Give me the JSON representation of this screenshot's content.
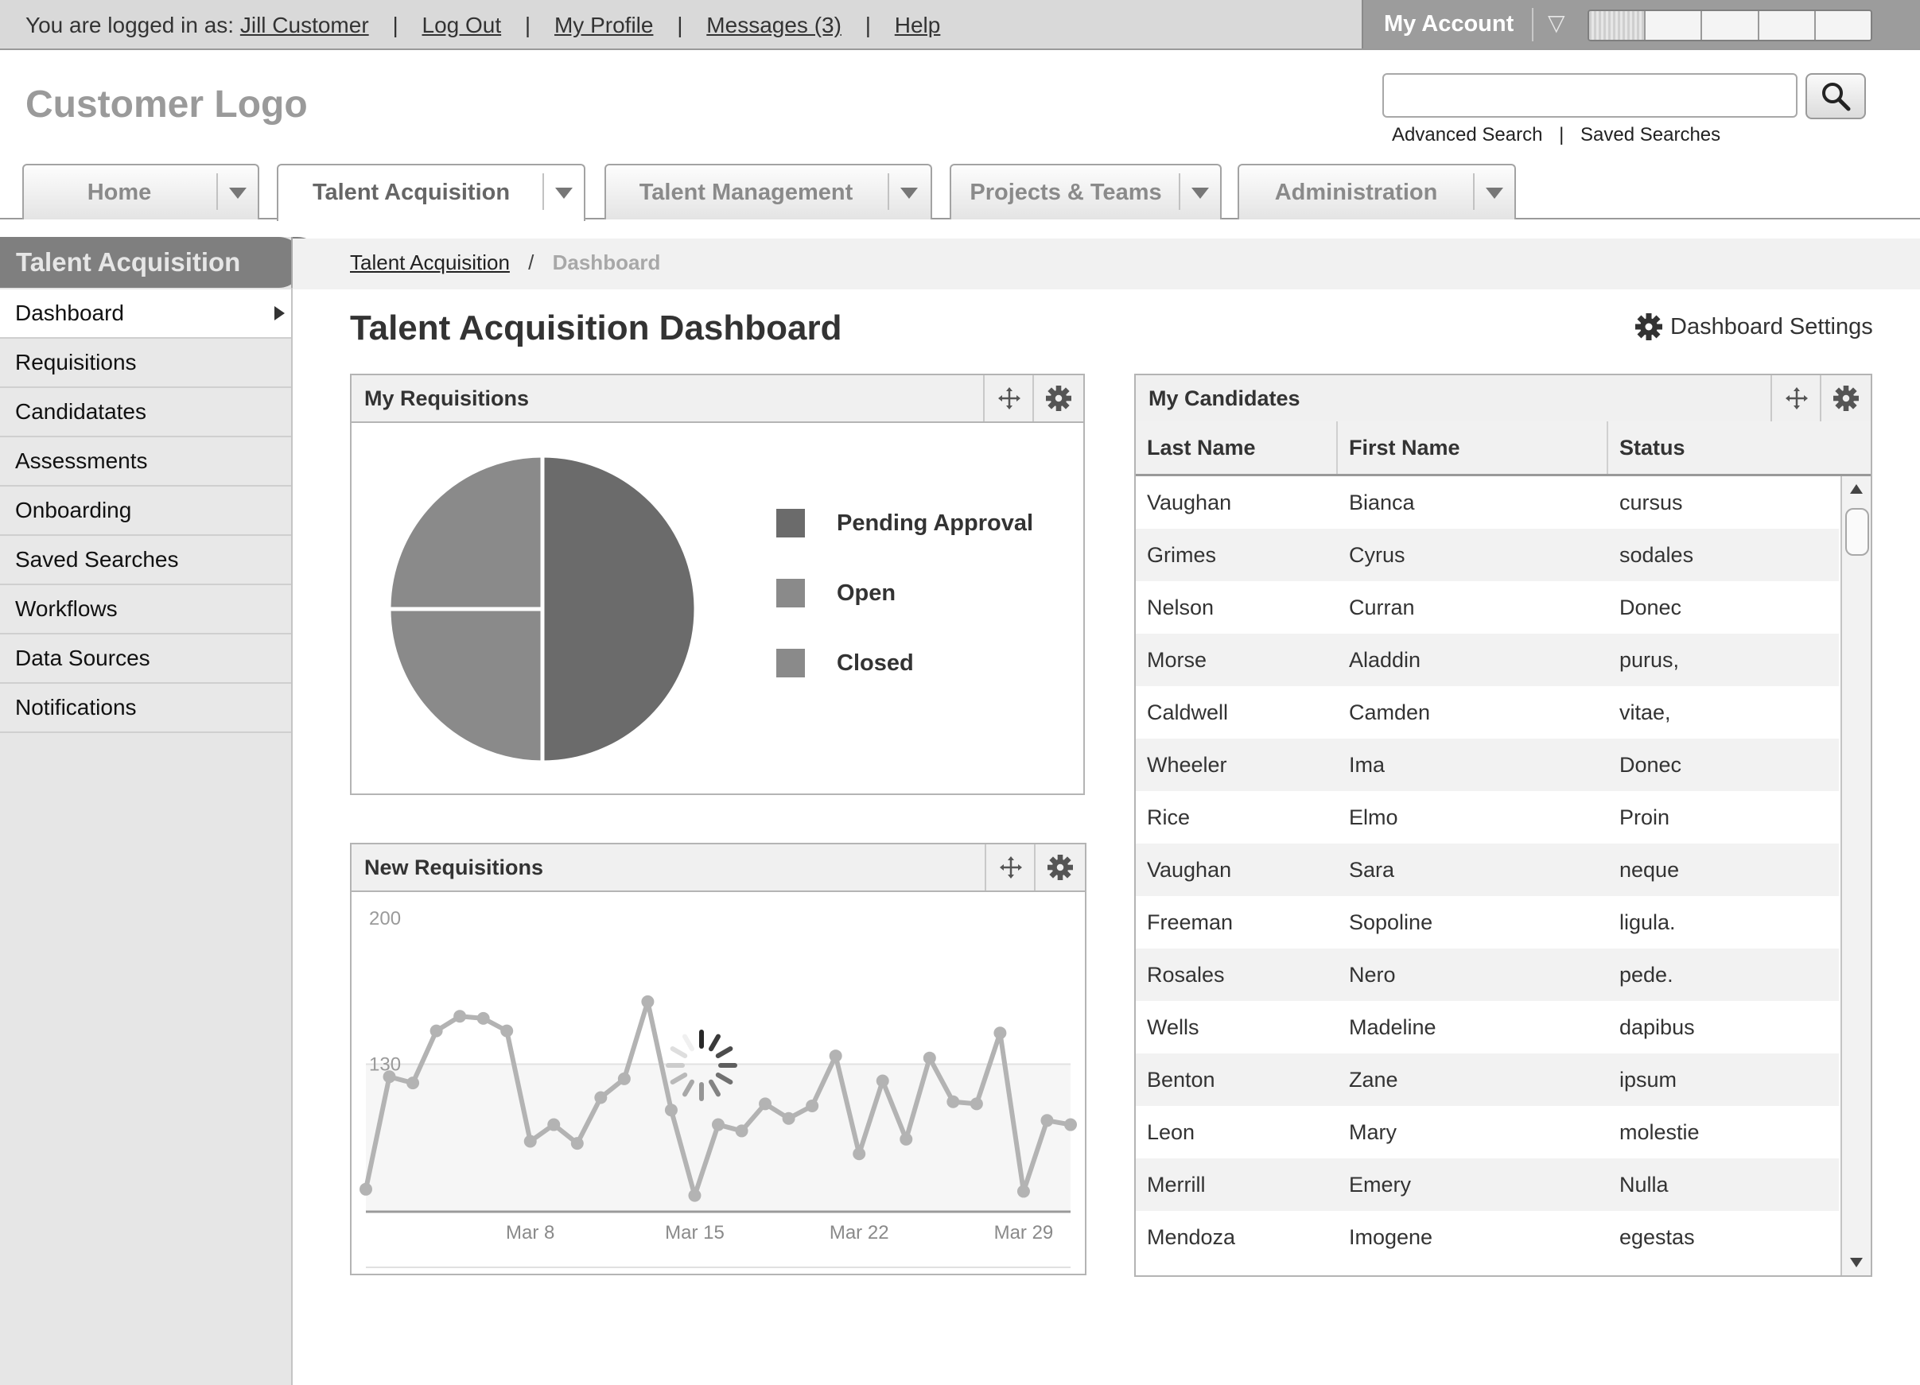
{
  "topbar": {
    "logged_in_prefix": "You are logged in as:",
    "user_name": "Jill Customer",
    "logout": "Log Out",
    "profile": "My Profile",
    "messages": "Messages (3)",
    "help": "Help",
    "separator": "|",
    "account_label": "My Account"
  },
  "header": {
    "logo": "Customer Logo",
    "search_placeholder": "",
    "advanced_search": "Advanced Search",
    "saved_searches": "Saved Searches",
    "separator": "|"
  },
  "tabs": [
    {
      "label": "Home"
    },
    {
      "label": "Talent Acquisition",
      "active": true
    },
    {
      "label": "Talent Management"
    },
    {
      "label": "Projects & Teams"
    },
    {
      "label": "Administration"
    }
  ],
  "sidebar": {
    "title": "Talent Acquisition",
    "items": [
      {
        "label": "Dashboard",
        "active": true
      },
      {
        "label": "Requisitions"
      },
      {
        "label": "Candidatates"
      },
      {
        "label": "Assessments"
      },
      {
        "label": "Onboarding"
      },
      {
        "label": "Saved Searches"
      },
      {
        "label": "Workflows"
      },
      {
        "label": "Data Sources"
      },
      {
        "label": "Notifications"
      }
    ]
  },
  "breadcrumb": {
    "parent": "Talent Acquisition",
    "separator": "/",
    "current": "Dashboard"
  },
  "page": {
    "title": "Talent Acquisition Dashboard",
    "settings_label": "Dashboard Settings"
  },
  "panels": {
    "requisitions": {
      "title": "My Requisitions",
      "legend": [
        {
          "label": "Pending Approval",
          "color": "#6b6b6b"
        },
        {
          "label": "Open",
          "color": "#8a8a8a"
        },
        {
          "label": "Closed",
          "color": "#8a8a8a"
        }
      ]
    },
    "new_requisitions": {
      "title": "New Requisitions"
    },
    "candidates": {
      "title": "My Candidates",
      "columns": [
        "Last Name",
        "First Name",
        "Status"
      ],
      "rows": [
        [
          "Vaughan",
          "Bianca",
          "cursus"
        ],
        [
          "Grimes",
          "Cyrus",
          "sodales"
        ],
        [
          "Nelson",
          "Curran",
          "Donec"
        ],
        [
          "Morse",
          "Aladdin",
          "purus,"
        ],
        [
          "Caldwell",
          "Camden",
          "vitae,"
        ],
        [
          "Wheeler",
          "Ima",
          "Donec"
        ],
        [
          "Rice",
          "Elmo",
          "Proin"
        ],
        [
          "Vaughan",
          "Sara",
          "neque"
        ],
        [
          "Freeman",
          "Sopoline",
          "ligula."
        ],
        [
          "Rosales",
          "Nero",
          "pede."
        ],
        [
          "Wells",
          "Madeline",
          "dapibus"
        ],
        [
          "Benton",
          "Zane",
          "ipsum"
        ],
        [
          "Leon",
          "Mary",
          "molestie"
        ],
        [
          "Merrill",
          "Emery",
          "Nulla"
        ],
        [
          "Mendoza",
          "Imogene",
          "egestas"
        ]
      ]
    }
  },
  "chart_data": [
    {
      "type": "pie",
      "title": "My Requisitions",
      "labels": [
        "Pending Approval",
        "Open",
        "Closed"
      ],
      "values": [
        50,
        25,
        25
      ],
      "colors": [
        "#6b6b6b",
        "#8a8a8a",
        "#8a8a8a"
      ]
    },
    {
      "type": "line",
      "title": "New Requisitions",
      "x_ticks": [
        "Mar 8",
        "Mar 15",
        "Mar 22",
        "Mar 29"
      ],
      "y_ticks": [
        200,
        130
      ],
      "ylim": [
        60,
        205
      ],
      "series": [
        {
          "color": "#b3b3b3",
          "values": [
            70,
            124,
            121,
            146,
            153,
            152,
            146,
            93,
            101,
            92,
            114,
            123,
            160,
            108,
            67,
            101,
            98,
            111,
            104,
            110,
            134,
            87,
            122,
            94,
            133,
            112,
            111,
            145,
            69,
            103,
            101
          ]
        }
      ],
      "loading_spinner": true
    }
  ]
}
